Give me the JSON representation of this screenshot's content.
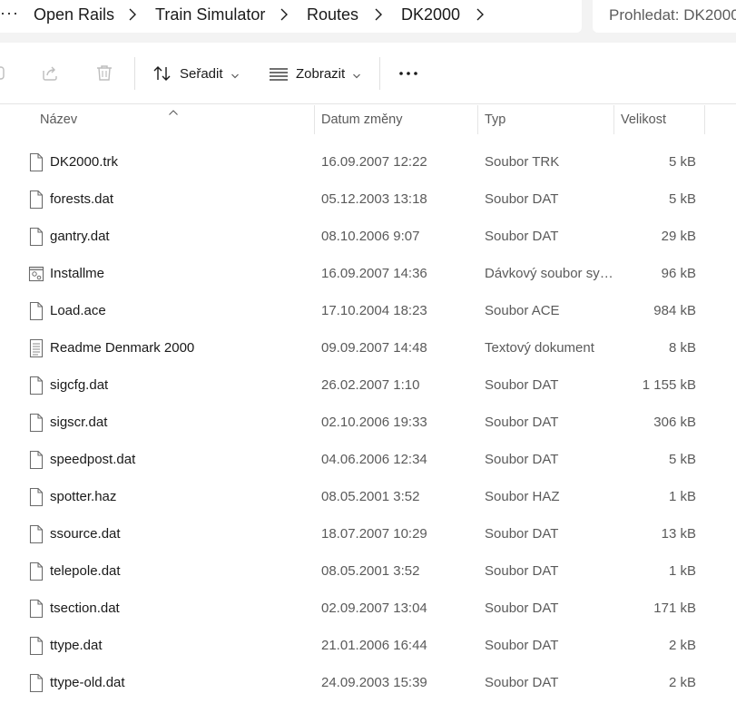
{
  "breadcrumb": {
    "overflow": "···",
    "items": [
      "Open Rails",
      "Train Simulator",
      "Routes",
      "DK2000"
    ]
  },
  "search": {
    "placeholder": "Prohledat: DK2000"
  },
  "toolbar": {
    "sort_label": "Seřadit",
    "view_label": "Zobrazit",
    "more_label": "•••"
  },
  "columns": {
    "name": "Název",
    "date": "Datum změny",
    "type": "Typ",
    "size": "Velikost"
  },
  "files": [
    {
      "name": "DK2000.trk",
      "date": "16.09.2007 12:22",
      "type": "Soubor TRK",
      "size": "5 kB",
      "icon": "file-icon"
    },
    {
      "name": "forests.dat",
      "date": "05.12.2003 13:18",
      "type": "Soubor DAT",
      "size": "5 kB",
      "icon": "file-icon"
    },
    {
      "name": "gantry.dat",
      "date": "08.10.2006 9:07",
      "type": "Soubor DAT",
      "size": "29 kB",
      "icon": "file-icon"
    },
    {
      "name": "Installme",
      "date": "16.09.2007 14:36",
      "type": "Dávkový soubor sy…",
      "size": "96 kB",
      "icon": "batch-file-icon"
    },
    {
      "name": "Load.ace",
      "date": "17.10.2004 18:23",
      "type": "Soubor ACE",
      "size": "984 kB",
      "icon": "file-icon"
    },
    {
      "name": "Readme Denmark 2000",
      "date": "09.09.2007 14:48",
      "type": "Textový dokument",
      "size": "8 kB",
      "icon": "text-document-icon"
    },
    {
      "name": "sigcfg.dat",
      "date": "26.02.2007 1:10",
      "type": "Soubor DAT",
      "size": "1 155 kB",
      "icon": "file-icon"
    },
    {
      "name": "sigscr.dat",
      "date": "02.10.2006 19:33",
      "type": "Soubor DAT",
      "size": "306 kB",
      "icon": "file-icon"
    },
    {
      "name": "speedpost.dat",
      "date": "04.06.2006 12:34",
      "type": "Soubor DAT",
      "size": "5 kB",
      "icon": "file-icon"
    },
    {
      "name": "spotter.haz",
      "date": "08.05.2001 3:52",
      "type": "Soubor HAZ",
      "size": "1 kB",
      "icon": "file-icon"
    },
    {
      "name": "ssource.dat",
      "date": "18.07.2007 10:29",
      "type": "Soubor DAT",
      "size": "13 kB",
      "icon": "file-icon"
    },
    {
      "name": "telepole.dat",
      "date": "08.05.2001 3:52",
      "type": "Soubor DAT",
      "size": "1 kB",
      "icon": "file-icon"
    },
    {
      "name": "tsection.dat",
      "date": "02.09.2007 13:04",
      "type": "Soubor DAT",
      "size": "171 kB",
      "icon": "file-icon"
    },
    {
      "name": "ttype.dat",
      "date": "21.01.2006 16:44",
      "type": "Soubor DAT",
      "size": "2 kB",
      "icon": "file-icon"
    },
    {
      "name": "ttype-old.dat",
      "date": "24.09.2003 15:39",
      "type": "Soubor DAT",
      "size": "2 kB",
      "icon": "file-icon"
    }
  ]
}
